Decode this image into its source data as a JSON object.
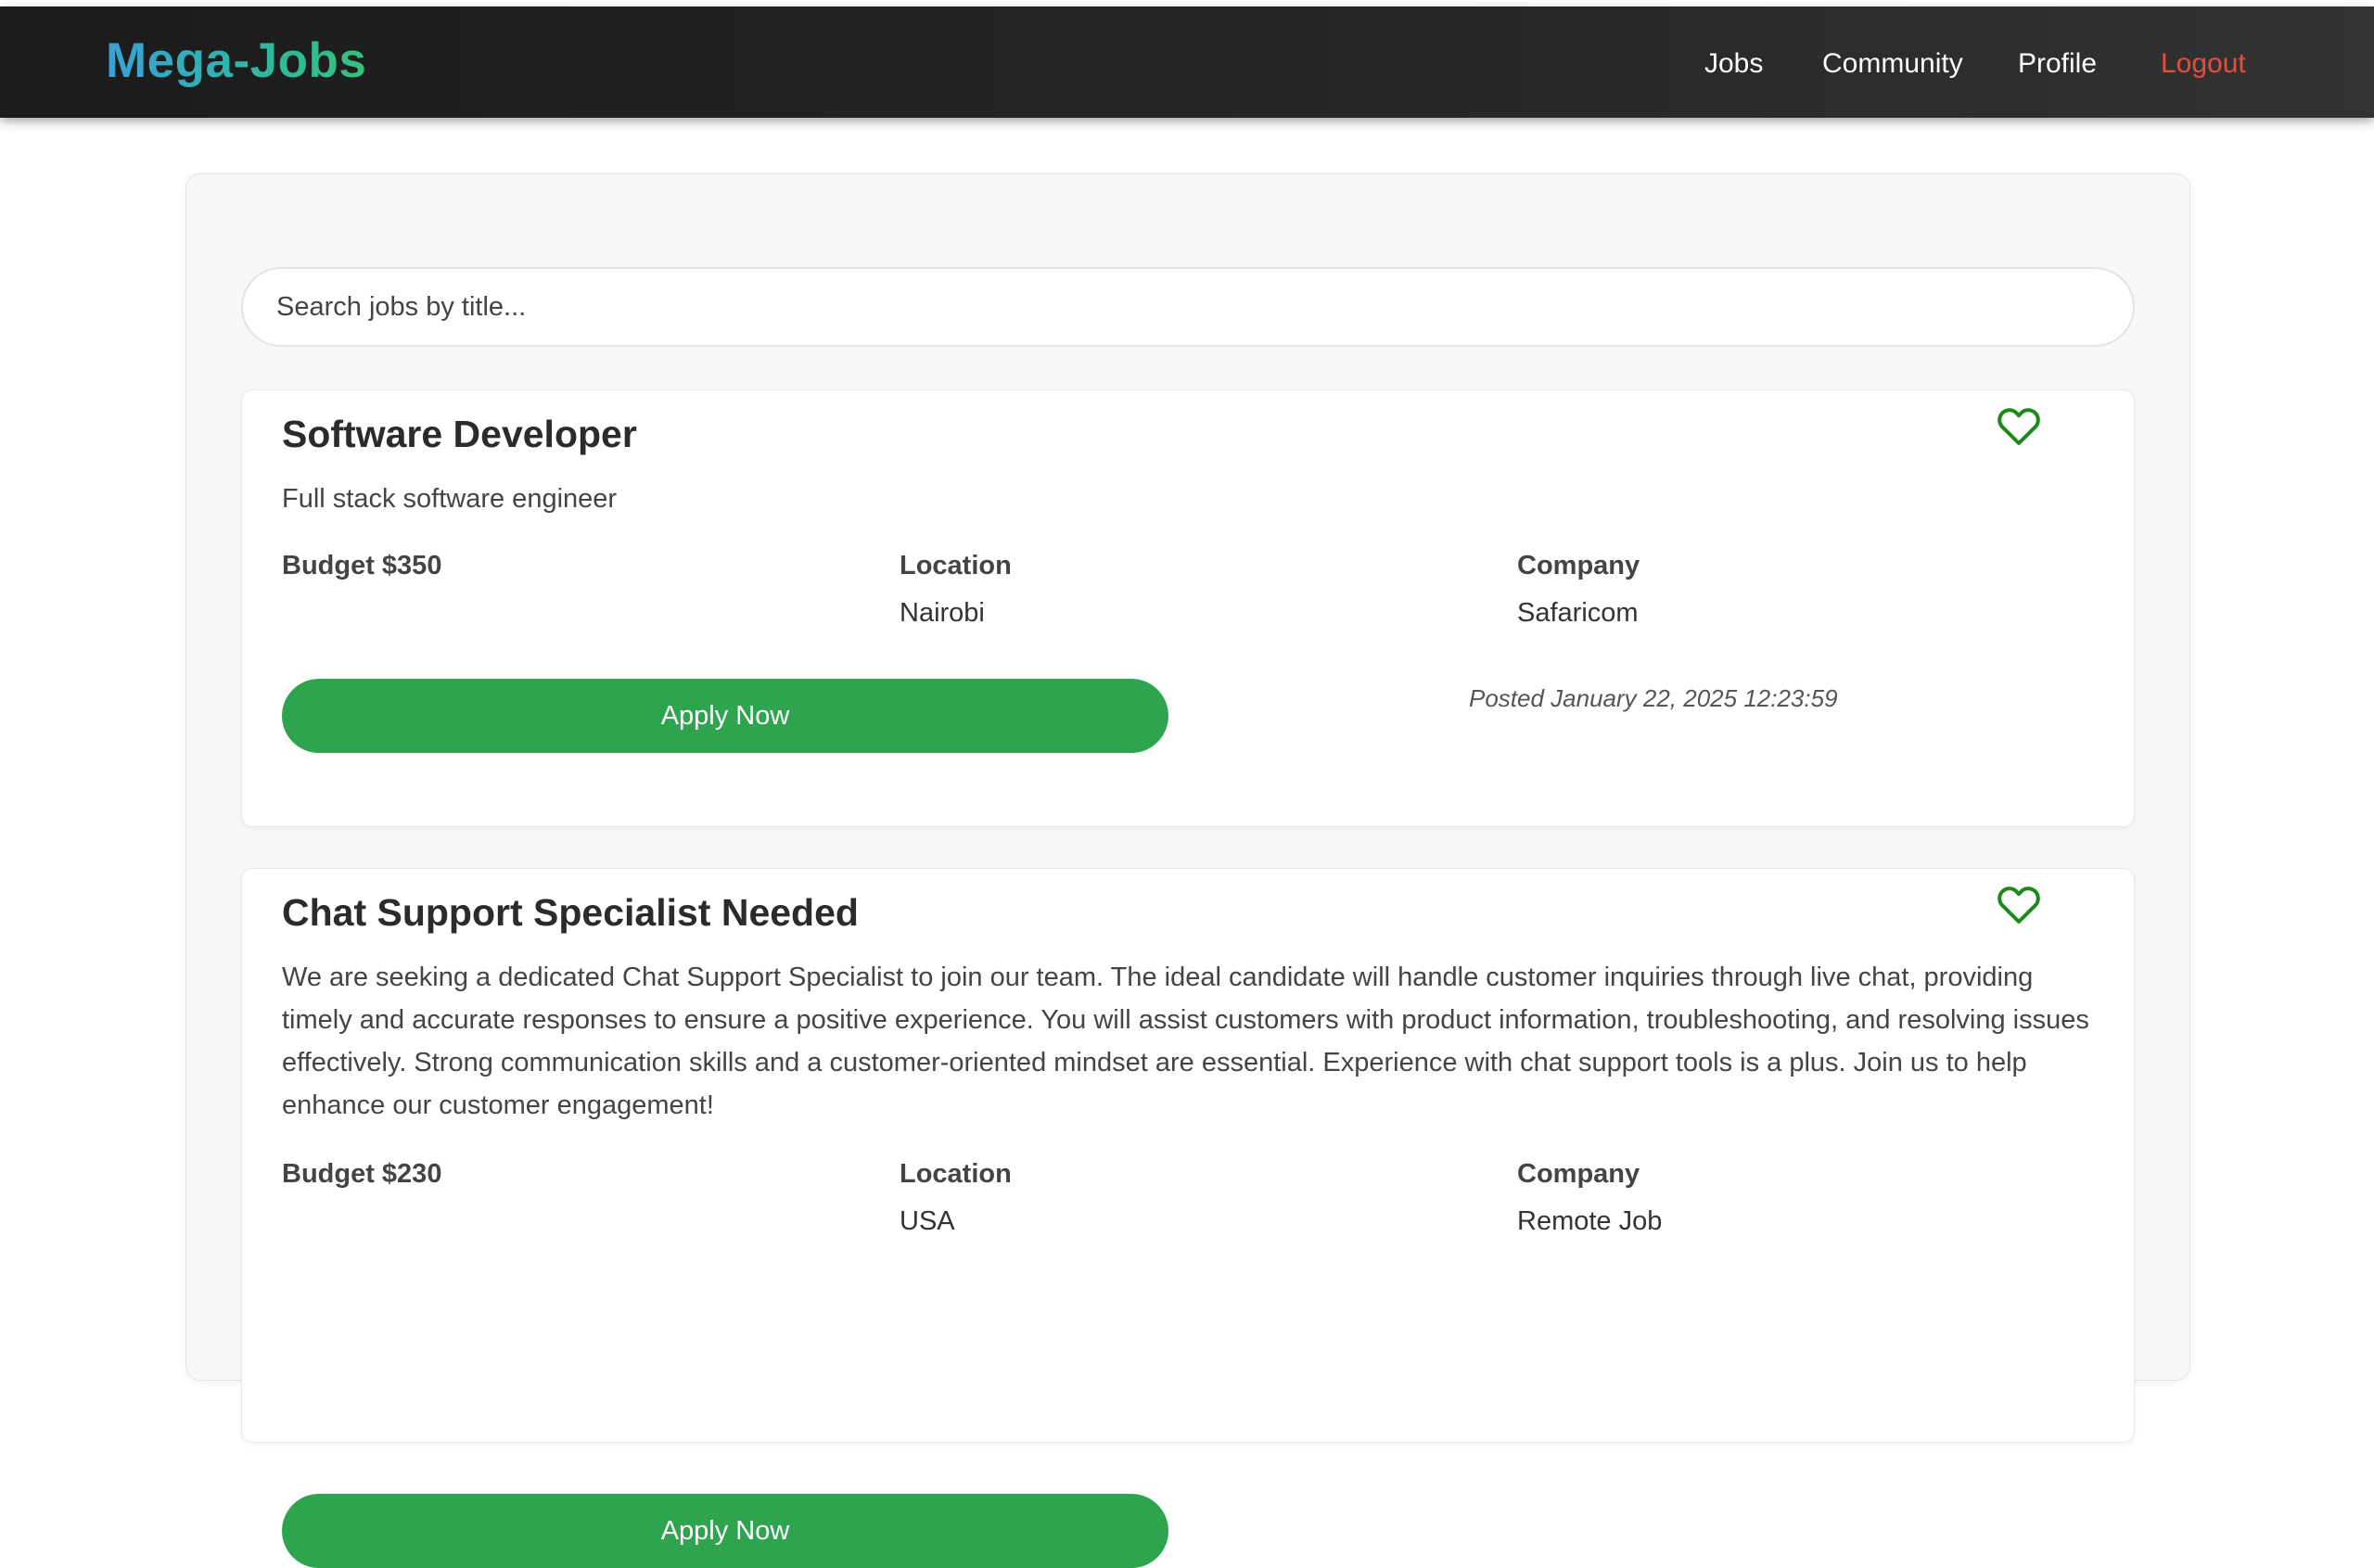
{
  "header": {
    "brand": "Mega-Jobs",
    "nav": {
      "jobs": "Jobs",
      "community": "Community",
      "profile": "Profile",
      "logout": "Logout"
    }
  },
  "search": {
    "placeholder": "Search jobs by title..."
  },
  "jobs": [
    {
      "title": "Software Developer",
      "description": "Full stack software engineer",
      "budget": "Budget $350",
      "location_label": "Location",
      "location": "Nairobi",
      "company_label": "Company",
      "company": "Safaricom",
      "apply_label": "Apply Now",
      "posted": "Posted January 22, 2025 12:23:59",
      "favorite_icon": "heart-outline-icon"
    },
    {
      "title": "Chat Support Specialist Needed",
      "description": "We are seeking a dedicated Chat Support Specialist to join our team. The ideal candidate will handle customer inquiries through live chat, providing timely and accurate responses to ensure a positive experience. You will assist customers with product information, troubleshooting, and resolving issues effectively. Strong communication skills and a customer-oriented mindset are essential. Experience with chat support tools is a plus. Join us to help enhance our customer engagement!",
      "budget": "Budget $230",
      "location_label": "Location",
      "location": "USA",
      "company_label": "Company",
      "company": "Remote Job",
      "apply_label": "Apply Now",
      "favorite_icon": "heart-outline-icon"
    }
  ],
  "colors": {
    "accent_green": "#2ea44f",
    "logout_red": "#e74c3c",
    "heart_green": "#1a8a1a"
  }
}
